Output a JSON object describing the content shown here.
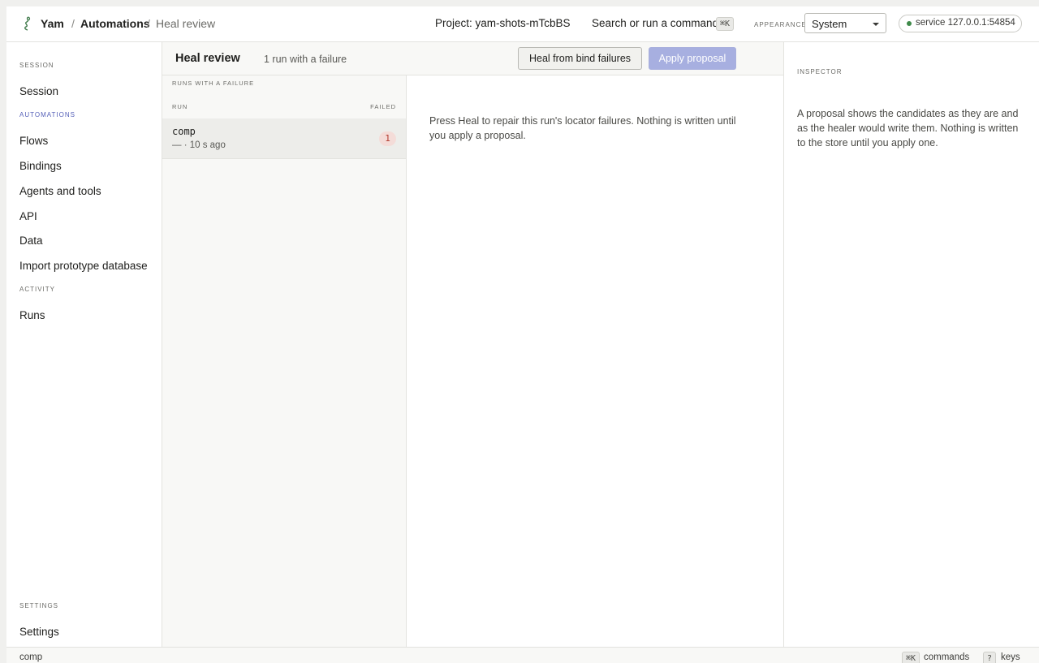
{
  "header": {
    "brand": "Yam",
    "separator": "/",
    "breadcrumb": [
      "Automations",
      "Heal review"
    ],
    "project": "Project: yam-shots-mTcbBS",
    "command_label": "Search or run a command",
    "command_shortcut": "⌘K",
    "appearance_label": "APPEARANCE",
    "appearance_value": "System",
    "service_status": "service 127.0.0.1:54854",
    "service_status_color": "#3f8a4a",
    "logo_icon": "yam-logo-icon"
  },
  "sidebar": {
    "sections": [
      {
        "label": "SESSION",
        "items": [
          "Session"
        ]
      },
      {
        "label": "AUTOMATIONS",
        "items": [
          "Flows",
          "Bindings",
          "Agents and tools",
          "API",
          "Data",
          "Import prototype database"
        ]
      },
      {
        "label": "ACTIVITY",
        "items": [
          "Runs"
        ]
      },
      {
        "label": "SETTINGS",
        "items": [
          "Settings"
        ]
      }
    ],
    "active_section_color": "#5560b8"
  },
  "main": {
    "title": "Heal review",
    "subtitle": "1 run with a failure",
    "heal_button": "Heal from bind failures",
    "apply_button": "Apply proposal",
    "apply_button_color": "#a7afe0"
  },
  "run_list": {
    "title": "RUNS WITH A FAILURE",
    "columns": {
      "run": "RUN",
      "failed": "FAILED"
    },
    "rows": [
      {
        "name": "comp",
        "meta": "— · 10 s ago",
        "failed": "1"
      }
    ]
  },
  "detail": {
    "message": "Press Heal to repair this run's locator failures. Nothing is written until you apply a proposal."
  },
  "inspector": {
    "title": "INSPECTOR",
    "body": "A proposal shows the candidates as they are and as the healer would write them. Nothing is written to the store until you apply one."
  },
  "statusbar": {
    "left": "comp",
    "commands_shortcut": "⌘K",
    "commands_label": "commands",
    "keys_shortcut": "?",
    "keys_label": "keys"
  }
}
